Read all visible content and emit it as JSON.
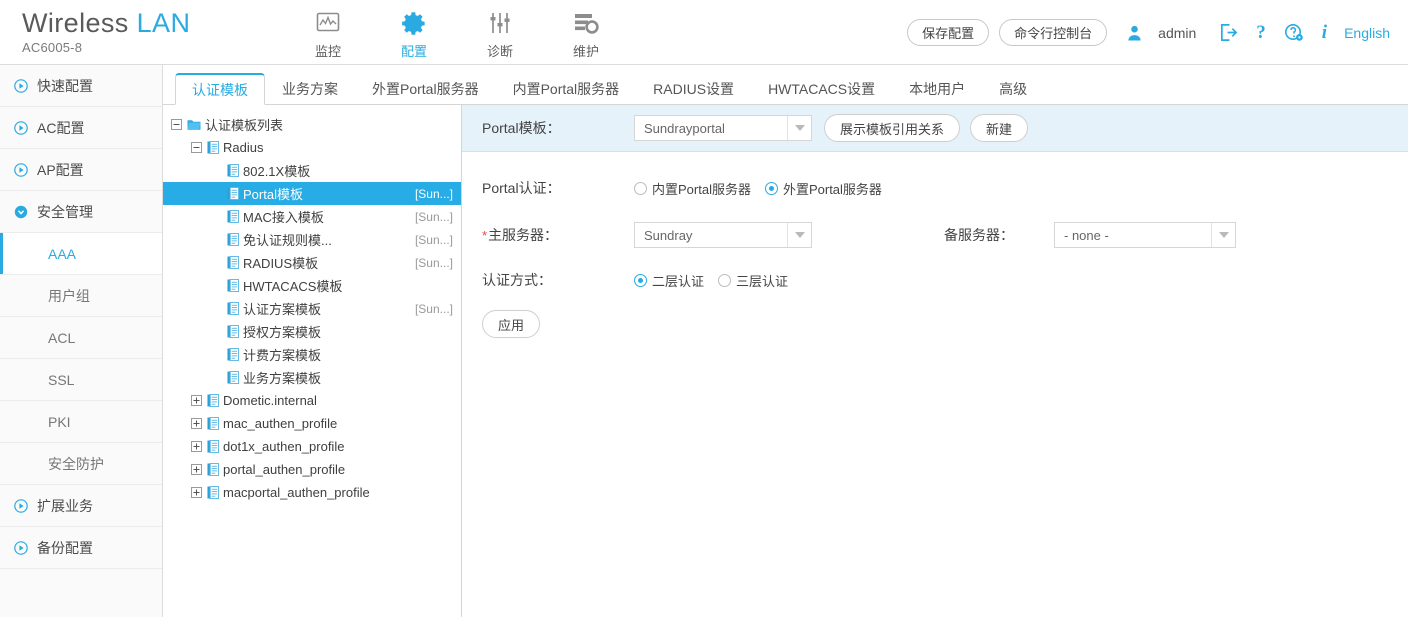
{
  "header": {
    "brand_main": "Wireless",
    "brand_accent": "LAN",
    "model": "AC6005-8",
    "nav": [
      {
        "label": "监控",
        "icon": "monitor-icon",
        "active": false
      },
      {
        "label": "配置",
        "icon": "gear-icon",
        "active": true
      },
      {
        "label": "诊断",
        "icon": "sliders-icon",
        "active": false
      },
      {
        "label": "维护",
        "icon": "server-gear-icon",
        "active": false
      }
    ],
    "save_config_label": "保存配置",
    "cli_console_label": "命令行控制台",
    "user_icon": "user-icon",
    "user_name": "admin",
    "logout_icon": "logout-icon",
    "help_icon": "question-mark-icon",
    "support_icon": "help-gear-icon",
    "info_icon": "info-icon",
    "language": "English"
  },
  "sidebar": {
    "items": [
      {
        "label": "快速配置",
        "type": "group",
        "icon": "chevron-right-circle-icon",
        "active": false
      },
      {
        "label": "AC配置",
        "type": "group",
        "icon": "chevron-right-circle-icon",
        "active": false
      },
      {
        "label": "AP配置",
        "type": "group",
        "icon": "chevron-right-circle-icon",
        "active": false
      },
      {
        "label": "安全管理",
        "type": "group-open",
        "icon": "chevron-down-circle-icon",
        "active": false
      },
      {
        "label": "AAA",
        "type": "sub",
        "active": true
      },
      {
        "label": "用户组",
        "type": "sub",
        "active": false
      },
      {
        "label": "ACL",
        "type": "sub",
        "active": false
      },
      {
        "label": "SSL",
        "type": "sub",
        "active": false
      },
      {
        "label": "PKI",
        "type": "sub",
        "active": false
      },
      {
        "label": "安全防护",
        "type": "sub",
        "active": false
      },
      {
        "label": "扩展业务",
        "type": "group",
        "icon": "chevron-right-circle-icon",
        "active": false
      },
      {
        "label": "备份配置",
        "type": "group",
        "icon": "chevron-right-circle-icon",
        "active": false
      }
    ]
  },
  "tabs": [
    {
      "label": "认证模板",
      "active": true
    },
    {
      "label": "业务方案",
      "active": false
    },
    {
      "label": "外置Portal服务器",
      "active": false
    },
    {
      "label": "内置Portal服务器",
      "active": false
    },
    {
      "label": "RADIUS设置",
      "active": false
    },
    {
      "label": "HWTACACS设置",
      "active": false
    },
    {
      "label": "本地用户",
      "active": false
    },
    {
      "label": "高级",
      "active": false
    }
  ],
  "tree": [
    {
      "label": "认证模板列表",
      "indent": 0,
      "expander": "minus",
      "icon": "folder-icon",
      "tag": "",
      "selected": false
    },
    {
      "label": "Radius",
      "indent": 1,
      "expander": "minus",
      "icon": "document-icon",
      "tag": "",
      "selected": false
    },
    {
      "label": "802.1X模板",
      "indent": 2,
      "expander": "none",
      "icon": "document-icon",
      "tag": "",
      "selected": false
    },
    {
      "label": "Portal模板",
      "indent": 2,
      "expander": "none",
      "icon": "document-icon",
      "tag": "[Sun...]",
      "selected": true
    },
    {
      "label": "MAC接入模板",
      "indent": 2,
      "expander": "none",
      "icon": "document-icon",
      "tag": "[Sun...]",
      "selected": false
    },
    {
      "label": "免认证规则模...",
      "indent": 2,
      "expander": "none",
      "icon": "document-icon",
      "tag": "[Sun...]",
      "selected": false
    },
    {
      "label": "RADIUS模板",
      "indent": 2,
      "expander": "none",
      "icon": "document-icon",
      "tag": "[Sun...]",
      "selected": false
    },
    {
      "label": "HWTACACS模板",
      "indent": 2,
      "expander": "none",
      "icon": "document-icon",
      "tag": "",
      "selected": false
    },
    {
      "label": "认证方案模板",
      "indent": 2,
      "expander": "none",
      "icon": "document-icon",
      "tag": "[Sun...]",
      "selected": false
    },
    {
      "label": "授权方案模板",
      "indent": 2,
      "expander": "none",
      "icon": "document-icon",
      "tag": "",
      "selected": false
    },
    {
      "label": "计费方案模板",
      "indent": 2,
      "expander": "none",
      "icon": "document-icon",
      "tag": "",
      "selected": false
    },
    {
      "label": "业务方案模板",
      "indent": 2,
      "expander": "none",
      "icon": "document-icon",
      "tag": "",
      "selected": false
    },
    {
      "label": "Dometic.internal",
      "indent": 1,
      "expander": "plus",
      "icon": "document-icon",
      "tag": "",
      "selected": false
    },
    {
      "label": "mac_authen_profile",
      "indent": 1,
      "expander": "plus",
      "icon": "document-icon",
      "tag": "",
      "selected": false
    },
    {
      "label": "dot1x_authen_profile",
      "indent": 1,
      "expander": "plus",
      "icon": "document-icon",
      "tag": "",
      "selected": false
    },
    {
      "label": "portal_authen_profile",
      "indent": 1,
      "expander": "plus",
      "icon": "document-icon",
      "tag": "",
      "selected": false
    },
    {
      "label": "macportal_authen_profile",
      "indent": 1,
      "expander": "plus",
      "icon": "document-icon",
      "tag": "",
      "selected": false
    }
  ],
  "form": {
    "portal_template_label": "Portal模板：",
    "portal_template_value": "Sundrayportal",
    "show_refs_button": "展示模板引用关系",
    "new_button": "新建",
    "portal_auth_label": "Portal认证：",
    "portal_auth_options": [
      {
        "label": "内置Portal服务器",
        "selected": false
      },
      {
        "label": "外置Portal服务器",
        "selected": true
      }
    ],
    "primary_server_label": "主服务器：",
    "primary_server_required": "*",
    "primary_server_value": "Sundray",
    "backup_server_label": "备服务器：",
    "backup_server_value": "- none -",
    "auth_mode_label": "认证方式：",
    "auth_mode_options": [
      {
        "label": "二层认证",
        "selected": true
      },
      {
        "label": "三层认证",
        "selected": false
      }
    ],
    "apply_button": "应用"
  },
  "colors": {
    "accent": "#29abe2",
    "selected_row": "#27ace5",
    "banner_bg": "#e5f2fa",
    "required": "#e24b3a"
  }
}
